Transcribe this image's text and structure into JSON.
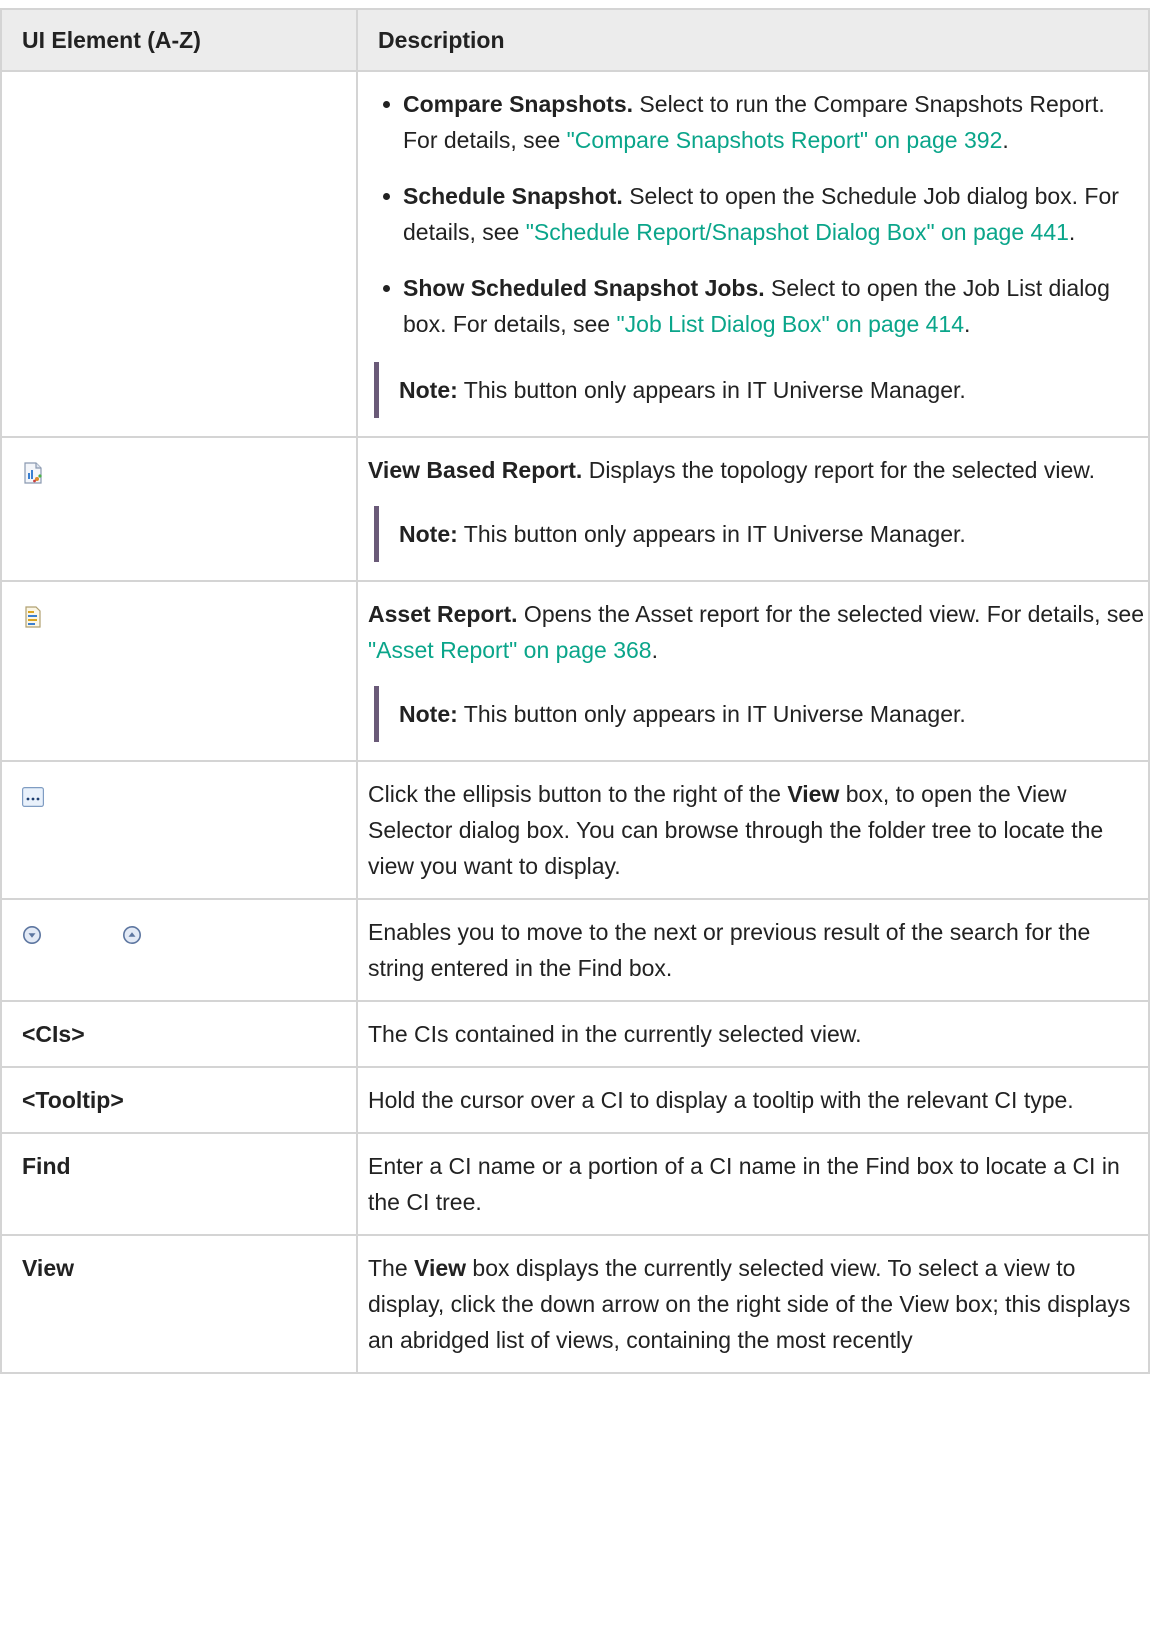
{
  "table": {
    "headers": {
      "element": "UI Element (A-Z)",
      "description": "Description"
    },
    "note_label": "Note:",
    "note_text": "This button only appears in IT Universe Manager.",
    "row_snapshot": {
      "options": [
        {
          "label": "Compare Snapshots.",
          "text": " Select to run the Compare Snapshots Report. For details, see ",
          "link": "\"Compare Snapshots Report\" on page 392",
          "after": "."
        },
        {
          "label": "Schedule Snapshot.",
          "text": " Select to open the Schedule Job dialog box. For details, see ",
          "link": "\"Schedule Report/Snapshot Dialog Box\" on page 441",
          "after": "."
        },
        {
          "label": "Show Scheduled Snapshot Jobs.",
          "text": " Select to open the Job List dialog box. For details, see ",
          "link": "\"Job List Dialog Box\" on page 414",
          "after": "."
        }
      ]
    },
    "row_view_report": {
      "icon": "view-based-report-icon",
      "label": "View Based Report.",
      "text": " Displays the topology report for the selected view."
    },
    "row_asset": {
      "icon": "asset-report-icon",
      "label": "Asset Report.",
      "text": " Opens the Asset report for the selected view. For details, see ",
      "link": "\"Asset Report\" on page 368",
      "after": "."
    },
    "row_ellipsis": {
      "icon": "ellipsis-button-icon",
      "text_a": "Click the ellipsis button to the right of the ",
      "bold": "View",
      "text_b": " box, to open the View Selector dialog box. You can browse through the folder tree to locate the view you want to display."
    },
    "row_nav": {
      "icons": [
        "next-result-icon",
        "previous-result-icon"
      ],
      "text": "Enables you to move to the next or previous result of the search for the string entered in the Find box."
    },
    "row_cis": {
      "element": "<CIs>",
      "text": "The CIs contained in the currently selected view."
    },
    "row_tooltip": {
      "element": "<Tooltip>",
      "text": "Hold the cursor over a CI to display a tooltip with the relevant CI type."
    },
    "row_find": {
      "element": "Find",
      "text": "Enter a CI name or a portion of a CI name in the Find box to locate a CI in the CI tree."
    },
    "row_view": {
      "element": "View",
      "text_a": "The ",
      "bold": "View",
      "text_b": " box displays the currently selected view. To select a view to display, click the down arrow on the right side of the View box; this displays an abridged list of views, containing the most recently"
    }
  }
}
